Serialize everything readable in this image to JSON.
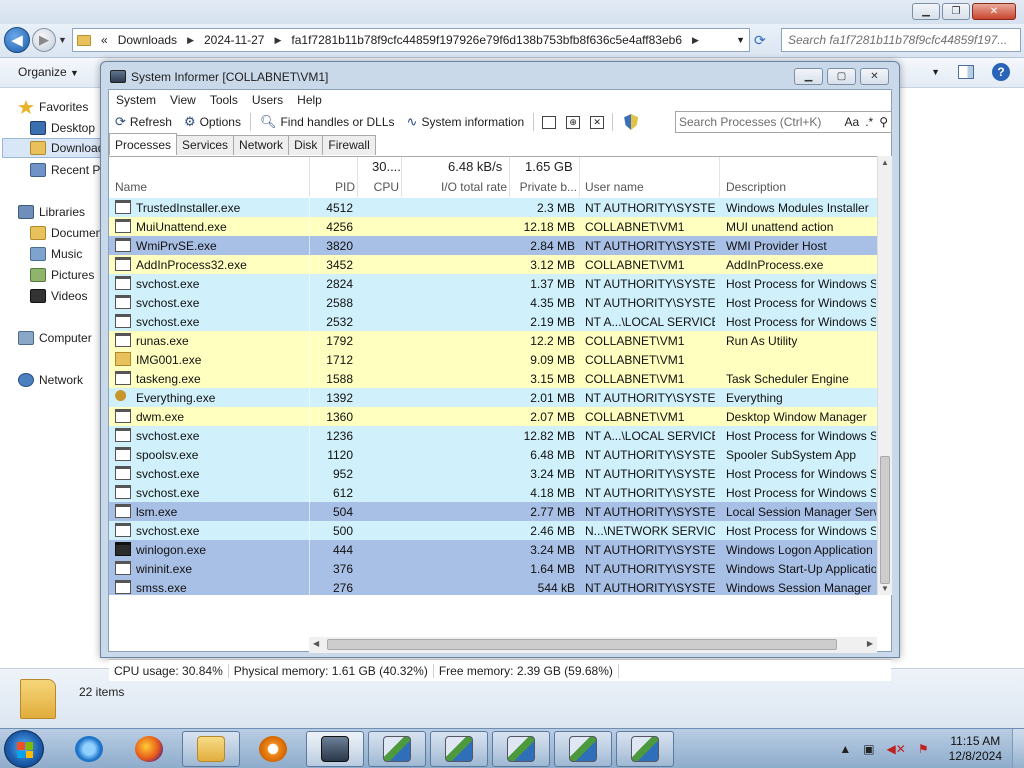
{
  "explorer": {
    "breadcrumb": [
      "Downloads",
      "2024-11-27",
      "fa1f7281b11b78f9cfc44859f197926e79f6d138b753bfb8f636c5e4aff83eb6"
    ],
    "breadcrumb_prefix": "«",
    "search_placeholder": "Search fa1f7281b11b78f9cfc44859f197...",
    "organize_label": "Organize",
    "nav": [
      {
        "label": "Favorites",
        "icon": "star-icon"
      },
      {
        "label": "Desktop",
        "icon": "desktop-icon"
      },
      {
        "label": "Downloads",
        "icon": "downloads-folder-icon",
        "selected": true
      },
      {
        "label": "Recent Places",
        "icon": "recent-places-icon"
      },
      {
        "label": "Libraries",
        "icon": "libraries-icon"
      },
      {
        "label": "Documents",
        "icon": "documents-icon"
      },
      {
        "label": "Music",
        "icon": "music-icon"
      },
      {
        "label": "Pictures",
        "icon": "pictures-icon"
      },
      {
        "label": "Videos",
        "icon": "videos-icon"
      },
      {
        "label": "Computer",
        "icon": "computer-icon"
      },
      {
        "label": "Network",
        "icon": "network-icon"
      }
    ],
    "items_count": "22 items"
  },
  "si": {
    "title": "System Informer [COLLABNET\\VM1]",
    "menu": [
      "System",
      "View",
      "Tools",
      "Users",
      "Help"
    ],
    "toolbar": {
      "refresh": "Refresh",
      "options": "Options",
      "find_handles": "Find handles or DLLs",
      "system_information": "System information"
    },
    "search_placeholder": "Search Processes (Ctrl+K)",
    "search_opt_case": "Aa",
    "search_opt_regex": ".*",
    "tabs": [
      "Processes",
      "Services",
      "Network",
      "Disk",
      "Firewall"
    ],
    "columns": {
      "name": "Name",
      "pid": "PID",
      "cpu": "CPU",
      "io": "I/O total rate",
      "private": "Private b...",
      "user": "User name",
      "desc": "Description"
    },
    "summary": {
      "cpu": "30....",
      "io": "6.48 kB/s",
      "private": "1.65 GB"
    },
    "colors": {
      "service": "#d0f1fb",
      "own": "#ffffc0",
      "system": "#a9c0e6"
    },
    "processes": [
      {
        "name": "TrustedInstaller.exe",
        "pid": "4512",
        "private": "2.3 MB",
        "user": "NT AUTHORITY\\SYSTEM",
        "desc": "Windows Modules Installer",
        "kind": "service",
        "icon": "app-icon"
      },
      {
        "name": "MuiUnattend.exe",
        "pid": "4256",
        "private": "12.18 MB",
        "user": "COLLABNET\\VM1",
        "desc": "MUI unattend action",
        "kind": "own",
        "icon": "app-icon"
      },
      {
        "name": "WmiPrvSE.exe",
        "pid": "3820",
        "private": "2.84 MB",
        "user": "NT AUTHORITY\\SYSTEM",
        "desc": "WMI Provider Host",
        "kind": "system",
        "icon": "app-icon"
      },
      {
        "name": "AddInProcess32.exe",
        "pid": "3452",
        "private": "3.12 MB",
        "user": "COLLABNET\\VM1",
        "desc": "AddInProcess.exe",
        "kind": "own",
        "icon": "app-icon"
      },
      {
        "name": "svchost.exe",
        "pid": "2824",
        "private": "1.37 MB",
        "user": "NT AUTHORITY\\SYSTEM",
        "desc": "Host Process for Windows Se",
        "kind": "service",
        "icon": "app-icon"
      },
      {
        "name": "svchost.exe",
        "pid": "2588",
        "private": "4.35 MB",
        "user": "NT AUTHORITY\\SYSTEM",
        "desc": "Host Process for Windows Se",
        "kind": "service",
        "icon": "app-icon"
      },
      {
        "name": "svchost.exe",
        "pid": "2532",
        "private": "2.19 MB",
        "user": "NT A...\\LOCAL SERVICE",
        "desc": "Host Process for Windows Se",
        "kind": "service",
        "icon": "app-icon"
      },
      {
        "name": "runas.exe",
        "pid": "1792",
        "private": "12.2 MB",
        "user": "COLLABNET\\VM1",
        "desc": "Run As Utility",
        "kind": "own",
        "icon": "app-icon"
      },
      {
        "name": "IMG001.exe",
        "pid": "1712",
        "private": "9.09 MB",
        "user": "COLLABNET\\VM1",
        "desc": "",
        "kind": "own",
        "icon": "folder-icon"
      },
      {
        "name": "taskeng.exe",
        "pid": "1588",
        "private": "3.15 MB",
        "user": "COLLABNET\\VM1",
        "desc": "Task Scheduler Engine",
        "kind": "own",
        "icon": "app-icon"
      },
      {
        "name": "Everything.exe",
        "pid": "1392",
        "private": "2.01 MB",
        "user": "NT AUTHORITY\\SYSTEM",
        "desc": "Everything",
        "kind": "service",
        "icon": "magnifier-icon"
      },
      {
        "name": "dwm.exe",
        "pid": "1360",
        "private": "2.07 MB",
        "user": "COLLABNET\\VM1",
        "desc": "Desktop Window Manager",
        "kind": "own",
        "icon": "app-icon"
      },
      {
        "name": "svchost.exe",
        "pid": "1236",
        "private": "12.82 MB",
        "user": "NT A...\\LOCAL SERVICE",
        "desc": "Host Process for Windows Se",
        "kind": "service",
        "icon": "app-icon"
      },
      {
        "name": "spoolsv.exe",
        "pid": "1120",
        "private": "6.48 MB",
        "user": "NT AUTHORITY\\SYSTEM",
        "desc": "Spooler SubSystem App",
        "kind": "service",
        "icon": "app-icon"
      },
      {
        "name": "svchost.exe",
        "pid": "952",
        "private": "3.24 MB",
        "user": "NT AUTHORITY\\SYSTEM",
        "desc": "Host Process for Windows Se",
        "kind": "service",
        "icon": "app-icon"
      },
      {
        "name": "svchost.exe",
        "pid": "612",
        "private": "4.18 MB",
        "user": "NT AUTHORITY\\SYSTEM",
        "desc": "Host Process for Windows Se",
        "kind": "service",
        "icon": "app-icon"
      },
      {
        "name": "lsm.exe",
        "pid": "504",
        "private": "2.77 MB",
        "user": "NT AUTHORITY\\SYSTEM",
        "desc": "Local Session Manager Servi",
        "kind": "system",
        "icon": "app-icon"
      },
      {
        "name": "svchost.exe",
        "pid": "500",
        "private": "2.46 MB",
        "user": "N...\\NETWORK SERVICE",
        "desc": "Host Process for Windows Se",
        "kind": "service",
        "icon": "app-icon"
      },
      {
        "name": "winlogon.exe",
        "pid": "444",
        "private": "3.24 MB",
        "user": "NT AUTHORITY\\SYSTEM",
        "desc": "Windows Logon Application",
        "kind": "system",
        "icon": "winlogon-icon"
      },
      {
        "name": "wininit.exe",
        "pid": "376",
        "private": "1.64 MB",
        "user": "NT AUTHORITY\\SYSTEM",
        "desc": "Windows Start-Up Applicatio",
        "kind": "system",
        "icon": "app-icon"
      },
      {
        "name": "smss.exe",
        "pid": "276",
        "private": "544 kB",
        "user": "NT AUTHORITY\\SYSTEM",
        "desc": "Windows Session Manager",
        "kind": "system",
        "icon": "app-icon"
      }
    ],
    "status": {
      "cpu": "CPU usage: 30.84%",
      "physical": "Physical memory: 1.61 GB (40.32%)",
      "free": "Free memory: 2.39 GB (59.68%)"
    }
  },
  "taskbar": {
    "apps": [
      {
        "name": "internet-explorer",
        "icon": "ie-icon",
        "boxed": false
      },
      {
        "name": "firefox",
        "icon": "firefox-icon",
        "boxed": false
      },
      {
        "name": "file-explorer",
        "icon": "explorer-folder-icon",
        "boxed": true
      },
      {
        "name": "media-player",
        "icon": "media-player-icon",
        "boxed": false
      },
      {
        "name": "system-informer",
        "icon": "system-informer-icon",
        "boxed": true,
        "active": true
      },
      {
        "name": "installer-1",
        "icon": "installer-icon",
        "boxed": true
      },
      {
        "name": "installer-2",
        "icon": "installer-icon",
        "boxed": true
      },
      {
        "name": "installer-3",
        "icon": "installer-icon",
        "boxed": true
      },
      {
        "name": "installer-4",
        "icon": "installer-icon",
        "boxed": true
      },
      {
        "name": "installer-5",
        "icon": "installer-icon",
        "boxed": true
      }
    ],
    "time": "11:15 AM",
    "date": "12/8/2024"
  }
}
